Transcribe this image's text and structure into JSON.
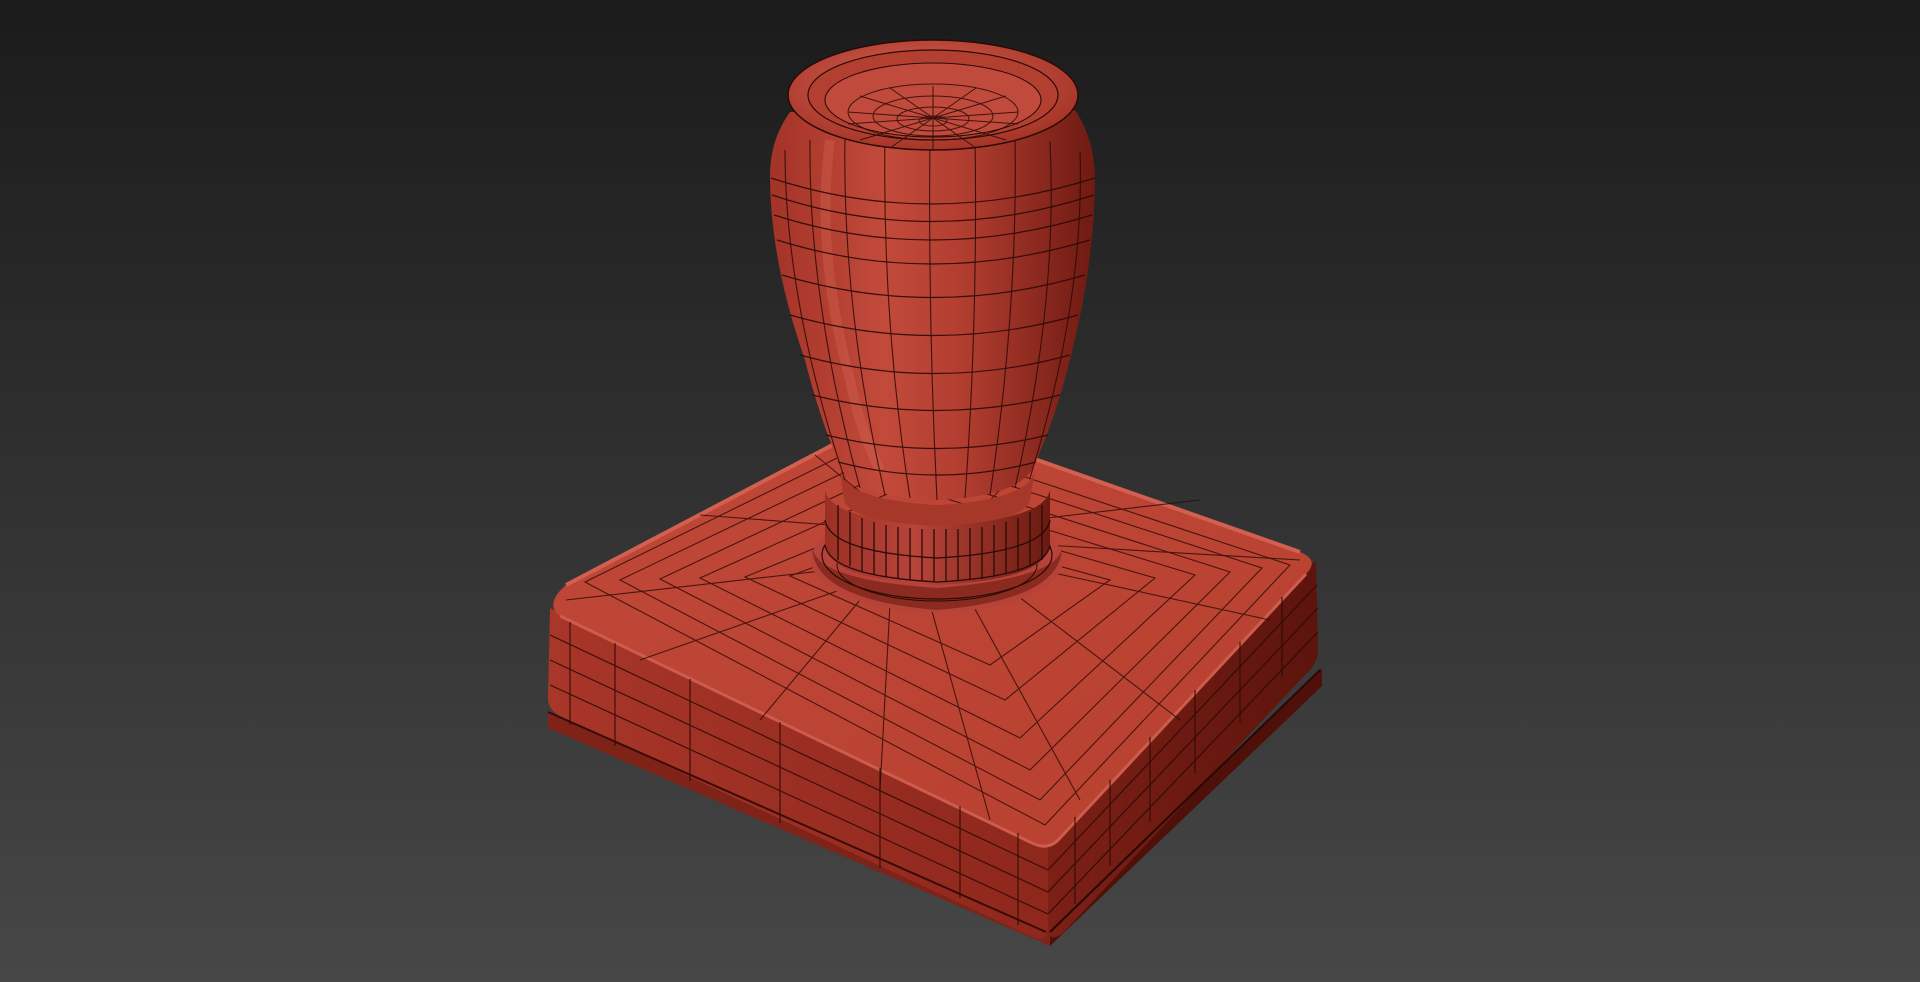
{
  "viewport": {
    "label": "",
    "background_top": "#1b1b1b",
    "background_bottom": "#474747"
  },
  "model": {
    "object": "rubber-stamp",
    "color_base": "#c24a3b",
    "color_shadow": "#6e1a12",
    "color_highlight": "#d9685a",
    "wire_color": "#2a0a06",
    "display_mode": "shaded-with-wireframe"
  }
}
